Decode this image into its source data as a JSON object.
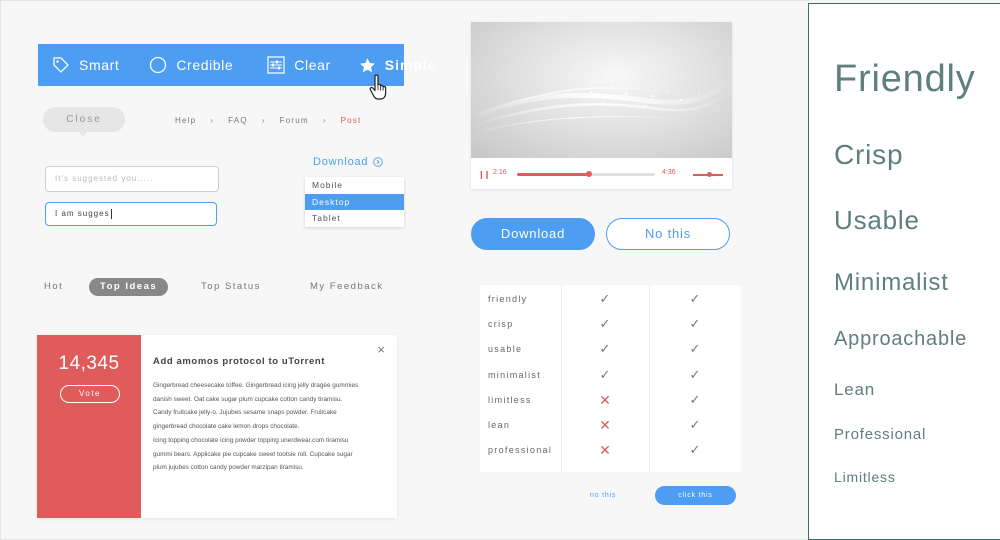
{
  "feature_bar": {
    "items": [
      {
        "label": "Smart",
        "icon": "tag-icon"
      },
      {
        "label": "Credible",
        "icon": "circle-icon"
      },
      {
        "label": "Clear",
        "icon": "sliders-icon"
      },
      {
        "label": "Simple",
        "icon": "star-icon"
      }
    ]
  },
  "close_label": "Close",
  "breadcrumb": {
    "items": [
      "Help",
      "FAQ",
      "Forum",
      "Post"
    ]
  },
  "inputs": {
    "placeholder": "It's suggested you.....",
    "active_value": "I am sugges"
  },
  "dropdown": {
    "title": "Download",
    "options": [
      "Mobile",
      "Desktop",
      "Tablet"
    ],
    "selected": "Desktop"
  },
  "tabs": {
    "items": [
      "Hot",
      "Top Ideas",
      "Top Status",
      "My Feedback"
    ],
    "active": "Top Ideas"
  },
  "card": {
    "vote_count": "14,345",
    "vote_label": "Vote",
    "title": "Add amomos protocol to uTorrent",
    "close_symbol": "×",
    "body_lines": [
      "Gingerbread cheesecake toffee. Gingerbread icing jelly dragée gummies",
      "danish sweet. Oat cake sugar plum cupcake cotton candy tiramisu.",
      "Candy fruitcake jelly-o. Jujubes sesame snaps powder. Fruitcake",
      "gingerbread chocolate cake lemon drops chocolate.",
      "Icing topping chocolate icing powder topping unerdwear.com tiramisu",
      "gummi bears. Applicake pie cupcake sweet tootsie roll. Cupcake sugar",
      "plum jujubes cotton candy powder marzipan tiramisu."
    ]
  },
  "player": {
    "current_time": "2:16",
    "end_time": "4:36",
    "progress": 0.52,
    "volume": 0.55
  },
  "buttons": {
    "download": "Download",
    "no_this": "No this"
  },
  "feature_table": {
    "rows": [
      {
        "label": "friendly",
        "a": "check",
        "b": "check"
      },
      {
        "label": "crisp",
        "a": "check",
        "b": "check"
      },
      {
        "label": "usable",
        "a": "check",
        "b": "check"
      },
      {
        "label": "minimalist",
        "a": "check",
        "b": "check"
      },
      {
        "label": "limitless",
        "a": "cross",
        "b": "check"
      },
      {
        "label": "lean",
        "a": "cross",
        "b": "check"
      },
      {
        "label": "professional",
        "a": "cross",
        "b": "check"
      }
    ],
    "no_this_link": "no this",
    "click_this_button": "click this"
  },
  "typography": {
    "words": [
      "Friendly",
      "Crisp",
      "Usable",
      "Minimalist",
      "Approachable",
      "Lean",
      "Professional",
      "Limitless"
    ]
  },
  "colors": {
    "accent_blue": "#4d9df2",
    "accent_red": "#e05c5c",
    "panel_teal": "#3c6e68"
  }
}
